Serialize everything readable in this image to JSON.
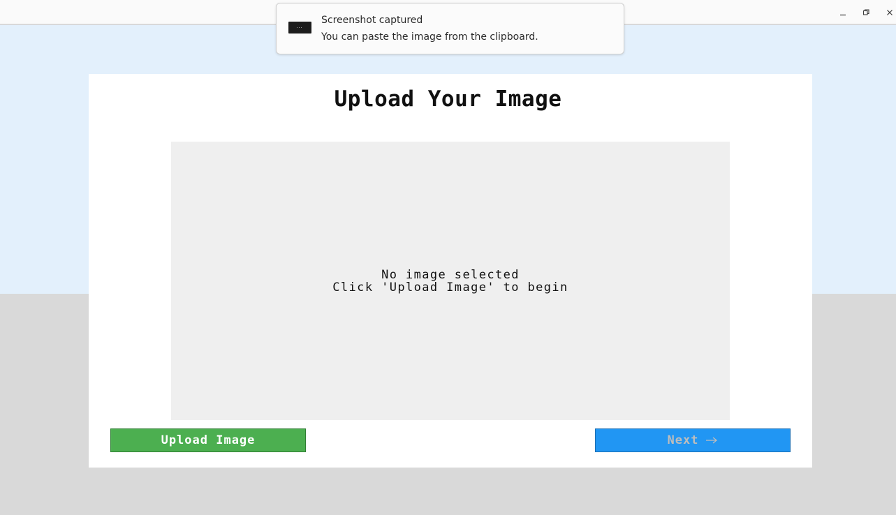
{
  "notification": {
    "title": "Screenshot captured",
    "body": "You can paste the image from the clipboard."
  },
  "window_controls": {
    "icons": [
      "minimize-icon",
      "restore-icon",
      "close-icon"
    ]
  },
  "page": {
    "title": "Upload Your Image"
  },
  "preview": {
    "line1": "No image selected",
    "line2": "Click 'Upload Image' to begin"
  },
  "buttons": {
    "upload_label": "Upload Image",
    "next_label": "Next",
    "next_icon": "arrow-right-icon"
  },
  "colors": {
    "upload_button": "#4caf50",
    "next_button": "#2196f3",
    "next_text_disabled": "#bdbdbd",
    "background_top": "#e3f0fc",
    "background_bottom": "#d9d9d9"
  }
}
